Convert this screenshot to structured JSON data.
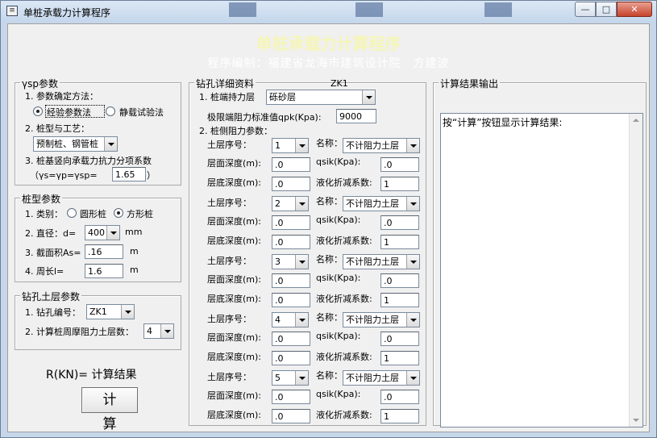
{
  "window": {
    "title": "单桩承载力计算程序",
    "min": "—",
    "max": "□",
    "close": "✕"
  },
  "banner": {
    "title": "单桩承载力计算程序",
    "subtitle": "程序编制：福建省龙海市建筑设计院　方建波"
  },
  "group_ysp": {
    "title": "γsp参数",
    "method_label": "1. 参数确定方法：",
    "opt_empirical": "经验参数法",
    "opt_static": "静载试验法",
    "method_selected": "经验参数法",
    "type_label": "2. 桩型与工艺：",
    "type_value": "预制桩、钢管桩",
    "coef_label": "3. 桩基竖向承载力抗力分项系数",
    "coef_formula_l": "（γs=γp=γsp=",
    "coef_value": "1.65",
    "coef_formula_r": "）"
  },
  "group_pile": {
    "title": "桩型参数",
    "kind_label": "1. 类别：",
    "opt_round": "圆形桩",
    "opt_square": "方形桩",
    "kind_selected": "方形桩",
    "dia_label": "2. 直径：d=",
    "dia_value": "400",
    "dia_unit": "mm",
    "area_label": "3. 截面积As=",
    "area_value": ".16",
    "area_unit": "m",
    "perim_label": "4. 周长l=",
    "perim_value": "1.6",
    "perim_unit": "m"
  },
  "group_bore": {
    "title": "钻孔土层参数",
    "no_label": "1. 钻孔编号：",
    "no_value": "ZK1",
    "layers_label": "2. 计算桩周摩阻力土层数：",
    "layers_value": "4"
  },
  "result_label": "R(KN)= 计算结果",
  "calc_button": "计 算",
  "detail": {
    "title": "钻孔详细资料",
    "bore_id": "ZK1",
    "bearing_label": "1. 桩端持力层",
    "bearing_value": "砾砂层",
    "qpk_label": "极限端阻力标准值qpk(Kpa):",
    "qpk_value": "9000",
    "side_label": "2. 桩侧阻力参数：",
    "lbl_seq": "土层序号：",
    "lbl_name": "名称：",
    "lbl_top": "层面深度(m):",
    "lbl_qsik": "qsik(Kpa):",
    "lbl_bottom": "层底深度(m):",
    "lbl_liq": "液化折减系数:",
    "layers": [
      {
        "seq": "1",
        "name": "不计阻力土层",
        "top": ".0",
        "qsik": ".0",
        "bottom": ".0",
        "liq": "1"
      },
      {
        "seq": "2",
        "name": "不计阻力土层",
        "top": ".0",
        "qsik": ".0",
        "bottom": ".0",
        "liq": "1"
      },
      {
        "seq": "3",
        "name": "不计阻力土层",
        "top": ".0",
        "qsik": ".0",
        "bottom": ".0",
        "liq": "1"
      },
      {
        "seq": "4",
        "name": "不计阻力土层",
        "top": ".0",
        "qsik": ".0",
        "bottom": ".0",
        "liq": "1"
      },
      {
        "seq": "5",
        "name": "不计阻力土层",
        "top": ".0",
        "qsik": ".0",
        "bottom": ".0",
        "liq": "1"
      }
    ]
  },
  "output": {
    "title": "计算结果输出",
    "text": "按“计算”按钮显示计算结果:"
  }
}
